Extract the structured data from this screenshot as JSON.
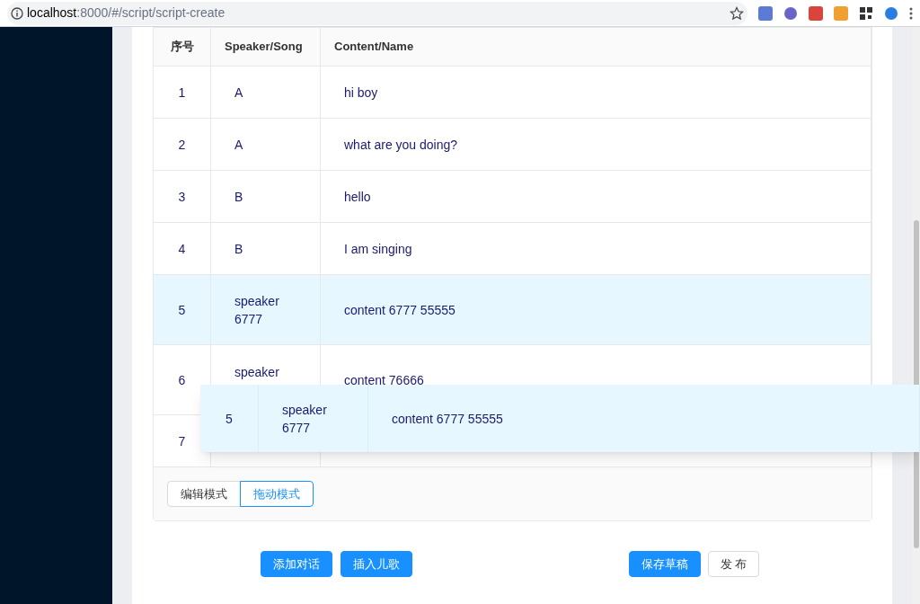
{
  "browser": {
    "url_host": "localhost",
    "url_path": ":8000/#/script/script-create"
  },
  "table": {
    "columns": [
      "序号",
      "Speaker/Song",
      "Content/Name"
    ],
    "rows": [
      {
        "index": "1",
        "speaker": "A",
        "content": "hi boy",
        "selected": false
      },
      {
        "index": "2",
        "speaker": "A",
        "content": "what are you doing?",
        "selected": false
      },
      {
        "index": "3",
        "speaker": "B",
        "content": "hello",
        "selected": false
      },
      {
        "index": "4",
        "speaker": "B",
        "content": "I am singing",
        "selected": false
      },
      {
        "index": "5",
        "speaker": "speaker 6777",
        "content": "content 6777 55555",
        "selected": true
      },
      {
        "index": "6",
        "speaker": "speaker",
        "content": "content 76666",
        "selected": false
      },
      {
        "index": "7",
        "selected": false
      }
    ]
  },
  "drag_ghost": {
    "index": "5",
    "speaker": "speaker 6777",
    "content": "content 6777 55555"
  },
  "modes": [
    {
      "label": "编辑模式",
      "selected": false
    },
    {
      "label": "拖动模式",
      "selected": true
    }
  ],
  "actions_left": [
    {
      "label": "添加对话",
      "kind": "primary"
    },
    {
      "label": "插入儿歌",
      "kind": "primary"
    }
  ],
  "actions_right": [
    {
      "label": "保存草稿",
      "kind": "primary"
    },
    {
      "label": "发 布",
      "kind": "default"
    }
  ]
}
